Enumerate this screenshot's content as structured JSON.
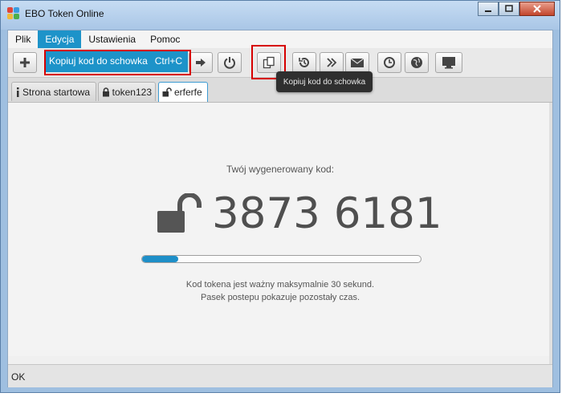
{
  "window": {
    "title": "EBO Token Online"
  },
  "menu": {
    "items": [
      "Plik",
      "Edycja",
      "Ustawienia",
      "Pomoc"
    ],
    "active": "Edycja"
  },
  "dropdown": {
    "label": "Kopiuj kod do schowka",
    "shortcut": "Ctrl+C"
  },
  "tooltip": {
    "text": "Kopiuj kod do schowka"
  },
  "tabs": [
    {
      "label": "Strona startowa",
      "icon": "info-icon"
    },
    {
      "label": "token123",
      "icon": "lock-icon"
    },
    {
      "label": "erferfe",
      "icon": "unlock-icon",
      "active": true
    }
  ],
  "main": {
    "subtitle": "Twój wygenerowany kod:",
    "code": "3873 6181",
    "progress": 0.13,
    "info_line1": "Kod tokena jest ważny maksymalnie 30 sekund.",
    "info_line2": "Pasek postepu pokazuje pozostały czas."
  },
  "status": {
    "text": "OK"
  },
  "colors": {
    "accent": "#1d93c9",
    "highlight": "#d60000",
    "progress": "#1e8fc8"
  }
}
